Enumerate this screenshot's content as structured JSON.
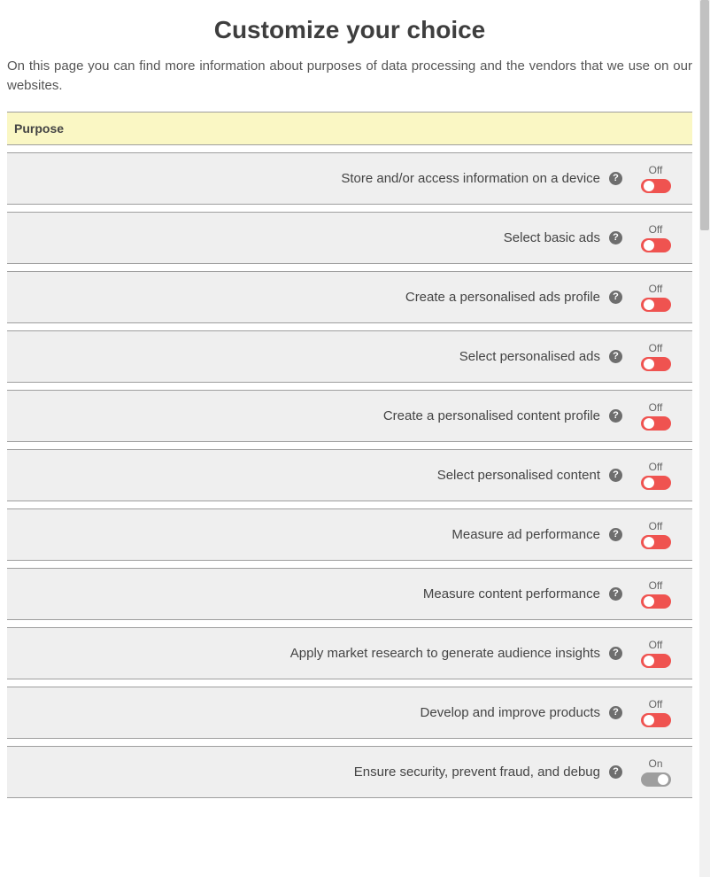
{
  "title": "Customize your choice",
  "intro": "On this page you can find more information about purposes of data processing and the vendors that we use on our websites.",
  "table_header": "Purpose",
  "state_labels": {
    "on": "On",
    "off": "Off"
  },
  "help_glyph": "?",
  "purposes": [
    {
      "label": "Store and/or access information on a device",
      "state": "off"
    },
    {
      "label": "Select basic ads",
      "state": "off"
    },
    {
      "label": "Create a personalised ads profile",
      "state": "off"
    },
    {
      "label": "Select personalised ads",
      "state": "off"
    },
    {
      "label": "Create a personalised content profile",
      "state": "off"
    },
    {
      "label": "Select personalised content",
      "state": "off"
    },
    {
      "label": "Measure ad performance",
      "state": "off"
    },
    {
      "label": "Measure content performance",
      "state": "off"
    },
    {
      "label": "Apply market research to generate audience insights",
      "state": "off"
    },
    {
      "label": "Develop and improve products",
      "state": "off"
    },
    {
      "label": "Ensure security, prevent fraud, and debug",
      "state": "on"
    }
  ]
}
